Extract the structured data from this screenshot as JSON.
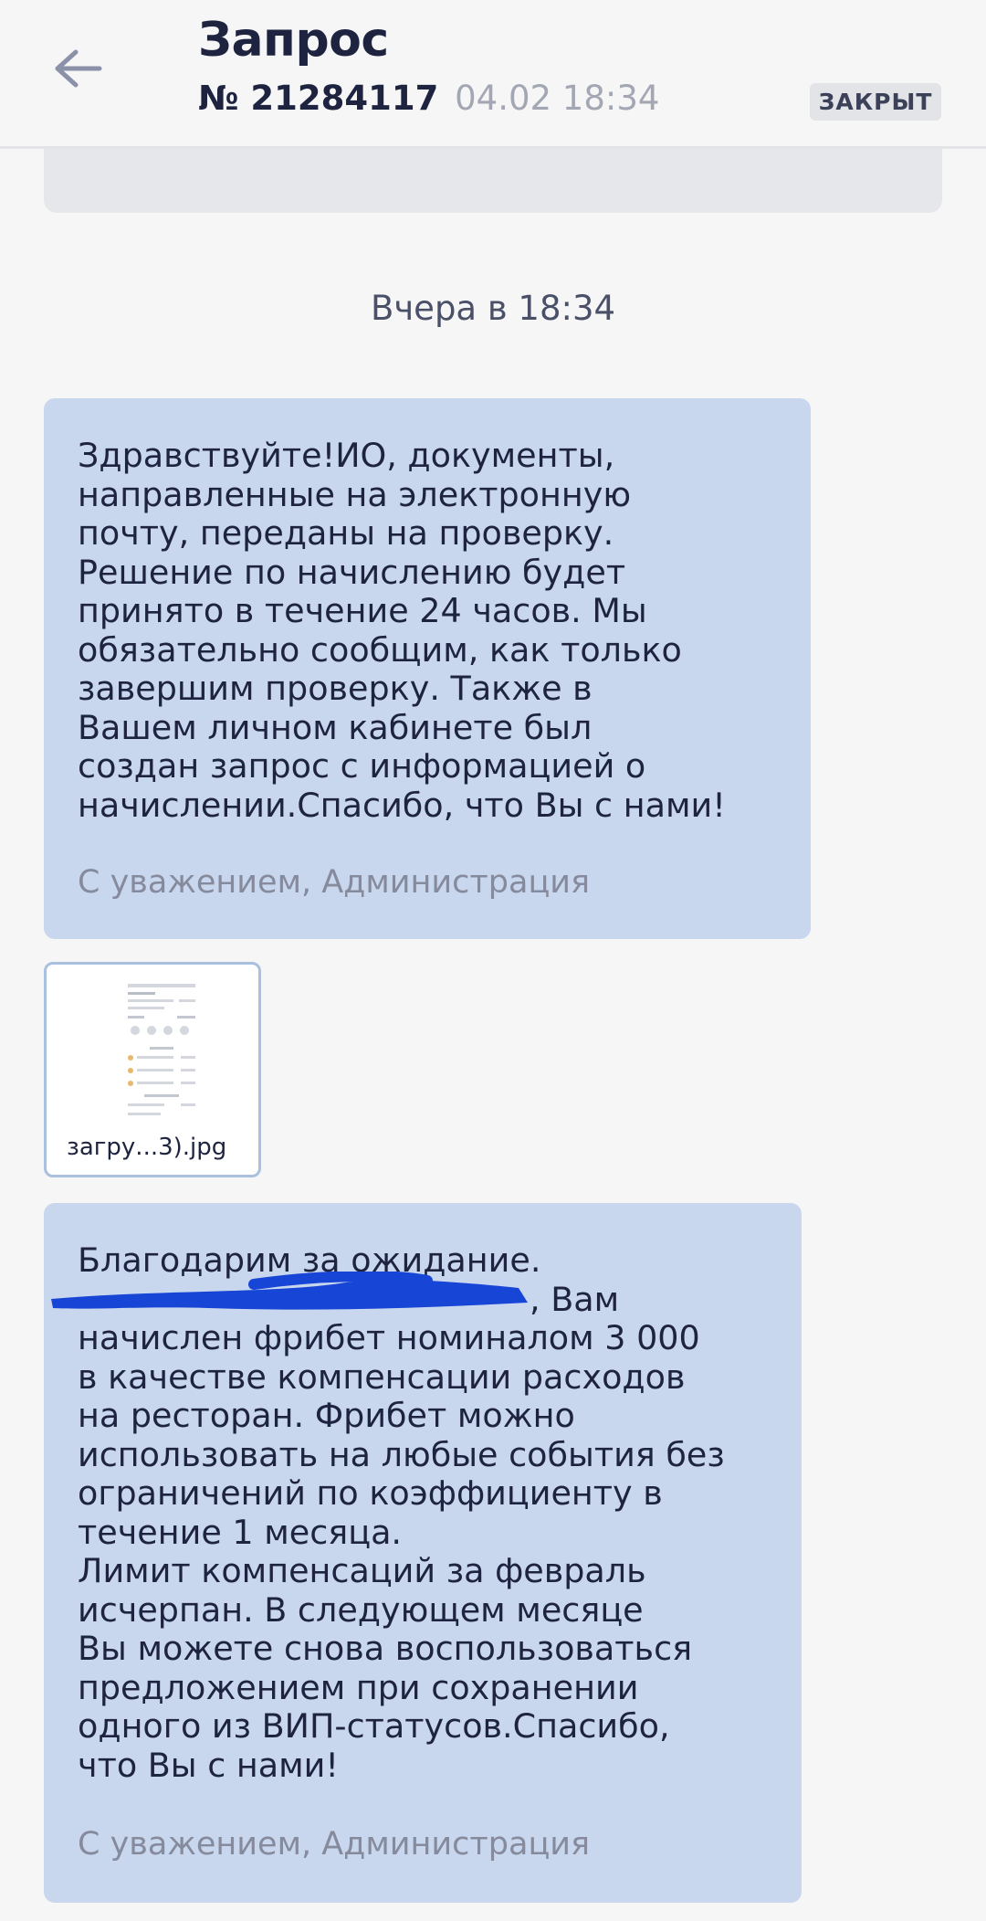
{
  "header": {
    "title": "Запрос",
    "request_number": "№ 21284117",
    "request_date": "04.02 18:34",
    "status": "ЗАКРЫТ"
  },
  "chat": {
    "date_separator": "Вчера в 18:34",
    "messages": [
      {
        "text": "Здравствуйте!ИО, документы,\nнаправленные на электронную\nпочту, переданы на проверку.\nРешение по начислению будет\nпринято в течение 24 часов. Мы\nобязательно сообщим, как только\nзавершим проверку. Также в\nВашем личном кабинете был\nсоздан запрос с информацией о\nначислении.Спасибо, что Вы с нами!",
        "signature": "С уважением, Администрация"
      },
      {
        "text": "Благодарим за ожидание.\n, Вам\nначислен фрибет номиналом 3 000\nв качестве компенсации расходов\nна ресторан. Фрибет можно\nиспользовать на любые события без\nограничений по коэффициенту в\nтечение 1 месяца.\nЛимит компенсаций за февраль\nисчерпан. В следующем месяце\nВы можете снова воспользоваться\nпредложением при сохранении\nодного из ВИП-статусов.Спасибо,\nчто Вы с нами!",
        "signature": "С уважением, Администрация"
      }
    ],
    "attachment": {
      "file_name": "загру...3).jpg",
      "icon": "image-thumbnail"
    }
  },
  "colors": {
    "bubble": "#c9d7ee",
    "background": "#f6f6f7",
    "text": "#1e2440",
    "redaction": "#1746d6"
  }
}
